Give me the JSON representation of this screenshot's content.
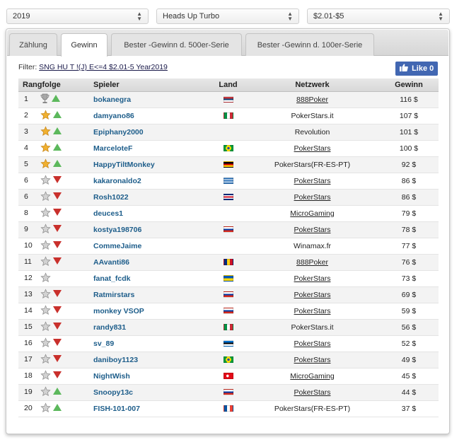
{
  "dropdowns": [
    {
      "id": "year",
      "value": "2019"
    },
    {
      "id": "game",
      "value": "Heads Up Turbo"
    },
    {
      "id": "stake",
      "value": "$2.01-$5"
    }
  ],
  "tabs": [
    "Zählung",
    "Gewinn",
    "Bester -Gewinn d. 500er-Serie",
    "Bester -Gewinn d. 100er-Serie"
  ],
  "active_tab": 1,
  "filter": {
    "label": "Filter:",
    "value": "SNG HU T !(J) E<=4 $2.01-5 Year2019"
  },
  "like_button": {
    "label": "Like 0"
  },
  "table": {
    "headers": [
      "Rangfolge",
      "Spieler",
      "Land",
      "Netzwerk",
      "Gewinn"
    ],
    "rows": [
      {
        "rank": "1",
        "icon": "trophy-icon",
        "trend": "up",
        "player": "bokanegra",
        "flag": "serbia",
        "network": "888Poker",
        "link": true,
        "win": "116 $"
      },
      {
        "rank": "2",
        "icon": "gold-star-icon",
        "trend": "up",
        "player": "damyano86",
        "flag": "italy",
        "network": "PokerStars.it",
        "link": false,
        "win": "107 $"
      },
      {
        "rank": "3",
        "icon": "gold-star-icon",
        "trend": "up",
        "player": "Epiphany2000",
        "flag": "",
        "network": "Revolution",
        "link": false,
        "win": "101 $"
      },
      {
        "rank": "4",
        "icon": "gold-star-icon",
        "trend": "up",
        "player": "MarceloteF",
        "flag": "brazil",
        "network": "PokerStars",
        "link": true,
        "win": "100 $"
      },
      {
        "rank": "5",
        "icon": "gold-star-icon",
        "trend": "up",
        "player": "HappyTiltMonkey",
        "flag": "germany",
        "network": "PokerStars(FR-ES-PT)",
        "link": false,
        "win": "92 $"
      },
      {
        "rank": "6",
        "icon": "silver-star-icon",
        "trend": "down",
        "player": "kakaronaldo2",
        "flag": "greece",
        "network": "PokerStars",
        "link": true,
        "win": "86 $"
      },
      {
        "rank": "6",
        "icon": "silver-star-icon",
        "trend": "down",
        "player": "Rosh1022",
        "flag": "costa-rica",
        "network": "PokerStars",
        "link": true,
        "win": "86 $"
      },
      {
        "rank": "8",
        "icon": "silver-star-icon",
        "trend": "down",
        "player": "deuces1",
        "flag": "",
        "network": "MicroGaming",
        "link": true,
        "win": "79 $"
      },
      {
        "rank": "9",
        "icon": "silver-star-icon",
        "trend": "down",
        "player": "kostya198706",
        "flag": "russia",
        "network": "PokerStars",
        "link": true,
        "win": "78 $"
      },
      {
        "rank": "10",
        "icon": "silver-star-icon",
        "trend": "down",
        "player": "CommeJaime",
        "flag": "",
        "network": "Winamax.fr",
        "link": false,
        "win": "77 $"
      },
      {
        "rank": "11",
        "icon": "silver-star-icon",
        "trend": "down",
        "player": "AAvanti86",
        "flag": "romania",
        "network": "888Poker",
        "link": true,
        "win": "76 $"
      },
      {
        "rank": "12",
        "icon": "silver-star-icon",
        "trend": "none",
        "player": "fanat_fcdk",
        "flag": "ukraine",
        "network": "PokerStars",
        "link": true,
        "win": "73 $"
      },
      {
        "rank": "13",
        "icon": "silver-star-icon",
        "trend": "down",
        "player": "Ratmirstars",
        "flag": "russia",
        "network": "PokerStars",
        "link": true,
        "win": "69 $"
      },
      {
        "rank": "14",
        "icon": "silver-star-icon",
        "trend": "down",
        "player": "monkey VSOP",
        "flag": "russia",
        "network": "PokerStars",
        "link": true,
        "win": "59 $"
      },
      {
        "rank": "15",
        "icon": "silver-star-icon",
        "trend": "down",
        "player": "randy831",
        "flag": "italy",
        "network": "PokerStars.it",
        "link": false,
        "win": "56 $"
      },
      {
        "rank": "16",
        "icon": "silver-star-icon",
        "trend": "down",
        "player": "sv_89",
        "flag": "estonia",
        "network": "PokerStars",
        "link": true,
        "win": "52 $"
      },
      {
        "rank": "17",
        "icon": "silver-star-icon",
        "trend": "down",
        "player": "daniboy1123",
        "flag": "brazil",
        "network": "PokerStars",
        "link": true,
        "win": "49 $"
      },
      {
        "rank": "18",
        "icon": "silver-star-icon",
        "trend": "down",
        "player": "NightWish",
        "flag": "turkey",
        "network": "MicroGaming",
        "link": true,
        "win": "45 $"
      },
      {
        "rank": "19",
        "icon": "silver-star-icon",
        "trend": "up",
        "player": "Snoopy13c",
        "flag": "russia",
        "network": "PokerStars",
        "link": true,
        "win": "44 $"
      },
      {
        "rank": "20",
        "icon": "silver-star-icon",
        "trend": "up",
        "player": "FISH-101-007",
        "flag": "france",
        "network": "PokerStars(FR-ES-PT)",
        "link": false,
        "win": "37 $"
      }
    ]
  },
  "colors": {
    "trend_up": "#5cb85c",
    "trend_down": "#c9302c",
    "player_link": "#1d5d8a",
    "like_button": "#4267b2",
    "gold_star": "#f0b030",
    "silver_star": "#a0a0a0"
  }
}
